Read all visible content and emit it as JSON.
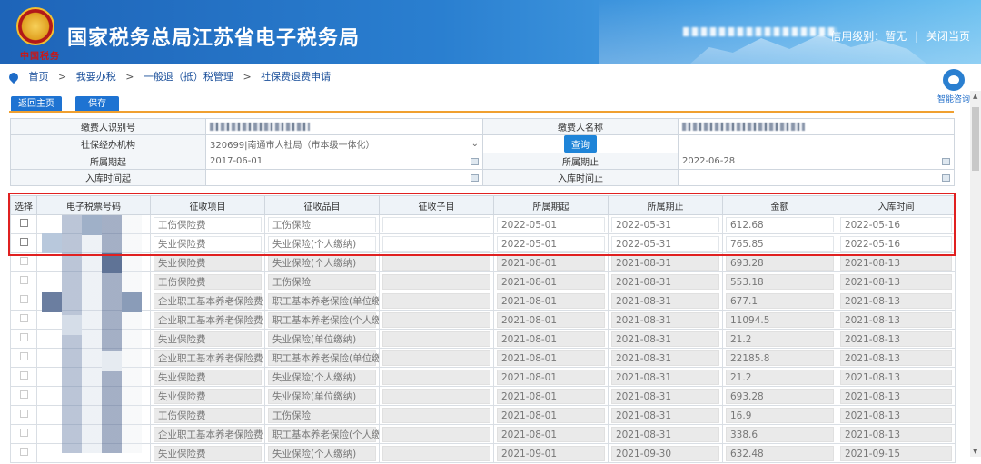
{
  "header": {
    "title": "国家税务总局江苏省电子税务局",
    "emblem_text": "中国税务",
    "credit_prefix": "信用级别：",
    "credit_value": "暂无",
    "divider": "|",
    "close_label": "关闭当页"
  },
  "breadcrumb": [
    "首页",
    "我要办税",
    "一般退（抵）税管理",
    "社保费退费申请"
  ],
  "breadcrumb_sep": ">",
  "help_label": "智能咨询",
  "toolbar": {
    "back_label": "返回主页",
    "save_label": "保存"
  },
  "form": {
    "payer_id_label": "缴费人识别号",
    "payer_name_label": "缴费人名称",
    "agency_label": "社保经办机构",
    "agency_value": "320699|南通市人社局（市本级一体化）",
    "query_label": "查询",
    "period_start_label": "所属期起",
    "period_start_value": "2017-06-01",
    "period_end_label": "所属期止",
    "period_end_value": "2022-06-28",
    "store_start_label": "入库时间起",
    "store_end_label": "入库时间止"
  },
  "table": {
    "headers": [
      "选择",
      "电子税票号码",
      "征收项目",
      "征收品目",
      "征收子目",
      "所属期起",
      "所属期止",
      "金额",
      "入库时间"
    ],
    "rows": [
      {
        "item": "工伤保险费",
        "sub": "工伤保险",
        "start": "2022-05-01",
        "end": "2022-05-31",
        "amount": "612.68",
        "date": "2022-05-16",
        "editable": true
      },
      {
        "item": "失业保险费",
        "sub": "失业保险(个人缴纳)",
        "start": "2022-05-01",
        "end": "2022-05-31",
        "amount": "765.85",
        "date": "2022-05-16",
        "editable": true
      },
      {
        "item": "失业保险费",
        "sub": "失业保险(个人缴纳)",
        "start": "2021-08-01",
        "end": "2021-08-31",
        "amount": "693.28",
        "date": "2021-08-13",
        "editable": false
      },
      {
        "item": "工伤保险费",
        "sub": "工伤保险",
        "start": "2021-08-01",
        "end": "2021-08-31",
        "amount": "553.18",
        "date": "2021-08-13",
        "editable": false
      },
      {
        "item": "企业职工基本养老保险费",
        "sub": "职工基本养老保险(单位缴",
        "start": "2021-08-01",
        "end": "2021-08-31",
        "amount": "677.1",
        "date": "2021-08-13",
        "editable": false
      },
      {
        "item": "企业职工基本养老保险费",
        "sub": "职工基本养老保险(个人缴",
        "start": "2021-08-01",
        "end": "2021-08-31",
        "amount": "11094.5",
        "date": "2021-08-13",
        "editable": false
      },
      {
        "item": "失业保险费",
        "sub": "失业保险(单位缴纳)",
        "start": "2021-08-01",
        "end": "2021-08-31",
        "amount": "21.2",
        "date": "2021-08-13",
        "editable": false
      },
      {
        "item": "企业职工基本养老保险费",
        "sub": "职工基本养老保险(单位缴",
        "start": "2021-08-01",
        "end": "2021-08-31",
        "amount": "22185.8",
        "date": "2021-08-13",
        "editable": false
      },
      {
        "item": "失业保险费",
        "sub": "失业保险(个人缴纳)",
        "start": "2021-08-01",
        "end": "2021-08-31",
        "amount": "21.2",
        "date": "2021-08-13",
        "editable": false
      },
      {
        "item": "失业保险费",
        "sub": "失业保险(单位缴纳)",
        "start": "2021-08-01",
        "end": "2021-08-31",
        "amount": "693.28",
        "date": "2021-08-13",
        "editable": false
      },
      {
        "item": "工伤保险费",
        "sub": "工伤保险",
        "start": "2021-08-01",
        "end": "2021-08-31",
        "amount": "16.9",
        "date": "2021-08-13",
        "editable": false
      },
      {
        "item": "企业职工基本养老保险费",
        "sub": "职工基本养老保险(个人缴",
        "start": "2021-08-01",
        "end": "2021-08-31",
        "amount": "338.6",
        "date": "2021-08-13",
        "editable": false
      },
      {
        "item": "失业保险费",
        "sub": "失业保险(个人缴纳)",
        "start": "2021-09-01",
        "end": "2021-09-30",
        "amount": "632.48",
        "date": "2021-09-15",
        "editable": false
      }
    ]
  },
  "colors": {
    "accent": "#1e73d2",
    "highlight": "#e02020",
    "rule": "#f0a030"
  }
}
